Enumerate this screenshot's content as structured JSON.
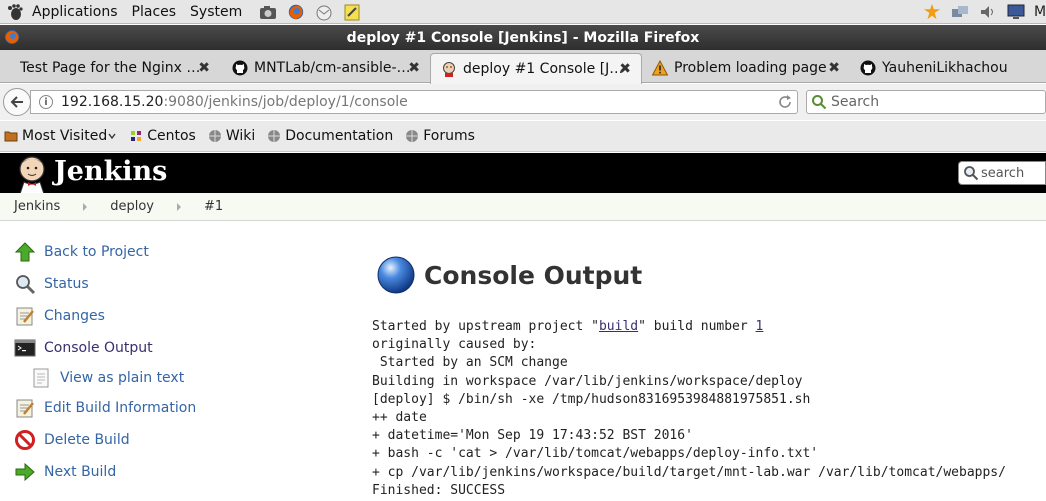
{
  "panel": {
    "menus": [
      "Applications",
      "Places",
      "System"
    ],
    "tray_clip": "M"
  },
  "window": {
    "title": "deploy #1 Console [Jenkins] - Mozilla Firefox"
  },
  "tabs": [
    {
      "label": "Test Page for the Nginx …",
      "icon": "none"
    },
    {
      "label": "MNTLab/cm-ansible-…",
      "icon": "github-icon"
    },
    {
      "label": "deploy #1 Console [J…",
      "icon": "jenkins-icon",
      "active": true
    },
    {
      "label": "Problem loading page",
      "icon": "warning-icon"
    },
    {
      "label": "YauheniLikhachou",
      "icon": "github-icon"
    }
  ],
  "nav": {
    "url_host": "192.168.15.20",
    "url_rest": ":9080/jenkins/job/deploy/1/console",
    "search_placeholder": "Search"
  },
  "bookmarks": [
    "Most Visited",
    "Centos",
    "Wiki",
    "Documentation",
    "Forums"
  ],
  "jenkins": {
    "brand": "Jenkins",
    "search_placeholder": "search"
  },
  "breadcrumb": [
    "Jenkins",
    "deploy",
    "#1"
  ],
  "side_tasks": [
    {
      "label": "Back to Project"
    },
    {
      "label": "Status"
    },
    {
      "label": "Changes"
    },
    {
      "label": "Console Output"
    },
    {
      "label": "View as plain text"
    },
    {
      "label": "Edit Build Information"
    },
    {
      "label": "Delete Build"
    },
    {
      "label": "Next Build"
    }
  ],
  "main": {
    "heading": "Console Output",
    "console": {
      "l1_pre": "Started by upstream project \"",
      "l1_link": "build",
      "l1_mid": "\" build number ",
      "l1_num": "1",
      "lines": [
        "originally caused by:",
        " Started by an SCM change",
        "Building in workspace /var/lib/jenkins/workspace/deploy",
        "[deploy] $ /bin/sh -xe /tmp/hudson8316953984881975851.sh",
        "++ date",
        "+ datetime='Mon Sep 19 17:43:52 BST 2016'",
        "+ bash -c 'cat > /var/lib/tomcat/webapps/deploy-info.txt'",
        "+ cp /var/lib/jenkins/workspace/build/target/mnt-lab.war /var/lib/tomcat/webapps/",
        "Finished: SUCCESS"
      ]
    }
  }
}
